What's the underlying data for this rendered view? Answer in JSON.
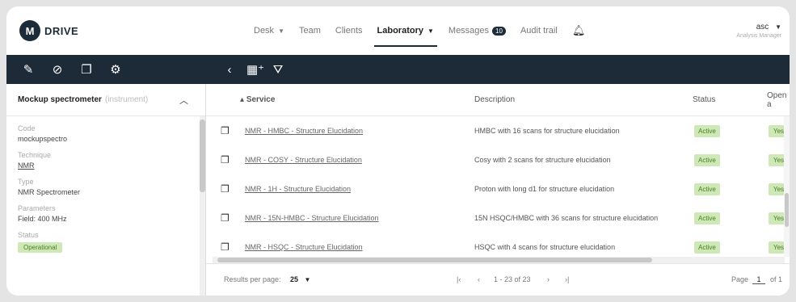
{
  "app": {
    "logo_letter": "M",
    "logo_text": "DRIVE"
  },
  "nav": {
    "items": [
      {
        "label": "Desk",
        "caret": true
      },
      {
        "label": "Team",
        "caret": false
      },
      {
        "label": "Clients",
        "caret": false
      },
      {
        "label": "Laboratory",
        "caret": true,
        "active": true
      },
      {
        "label": "Messages",
        "badge": "10"
      },
      {
        "label": "Audit trail"
      }
    ]
  },
  "user": {
    "name": "asc",
    "role": "Analysis Manager"
  },
  "toolbar": {
    "left_icons": [
      "pencil-icon",
      "no-link-icon",
      "copy-icon",
      "badge-icon"
    ],
    "right_icons": [
      "back-icon",
      "add-calendar-icon",
      "filter-icon"
    ]
  },
  "panel": {
    "title": "Mockup spectrometer",
    "subtitle": "(instrument)",
    "fields": [
      {
        "label": "Code",
        "value": "mockupspectro",
        "link": false
      },
      {
        "label": "Technique",
        "value": "NMR",
        "link": true
      },
      {
        "label": "Type",
        "value": "NMR Spectrometer",
        "link": false
      },
      {
        "label": "Parameters",
        "value": "Field: 400 MHz",
        "link": false
      },
      {
        "label": "Status",
        "value": "Operational",
        "pill": true
      }
    ]
  },
  "table": {
    "columns": [
      "Service",
      "Description",
      "Status",
      "Open a"
    ],
    "rows": [
      {
        "service": "NMR - HMBC - Structure Elucidation",
        "description": "HMBC with 16 scans for structure elucidation",
        "status": "Active",
        "open": "Yes"
      },
      {
        "service": "NMR - COSY - Structure Elucidation",
        "description": "Cosy with 2 scans for structure elucidation",
        "status": "Active",
        "open": "Yes"
      },
      {
        "service": "NMR - 1H - Structure Elucidation",
        "description": "Proton with long d1 for structure elucidation",
        "status": "Active",
        "open": "Yes"
      },
      {
        "service": "NMR - 15N-HMBC - Structure Elucidation",
        "description": "15N HSQC/HMBC with 36 scans for structure elucidation",
        "status": "Active",
        "open": "Yes"
      },
      {
        "service": "NMR - HSQC - Structure Elucidation",
        "description": "HSQC with 4 scans for structure elucidation",
        "status": "Active",
        "open": "Yes"
      }
    ]
  },
  "footer": {
    "results_label": "Results per page:",
    "results_value": "25",
    "range": "1 - 23 of 23",
    "page_label": "Page",
    "page_value": "1",
    "page_of": "of 1"
  }
}
